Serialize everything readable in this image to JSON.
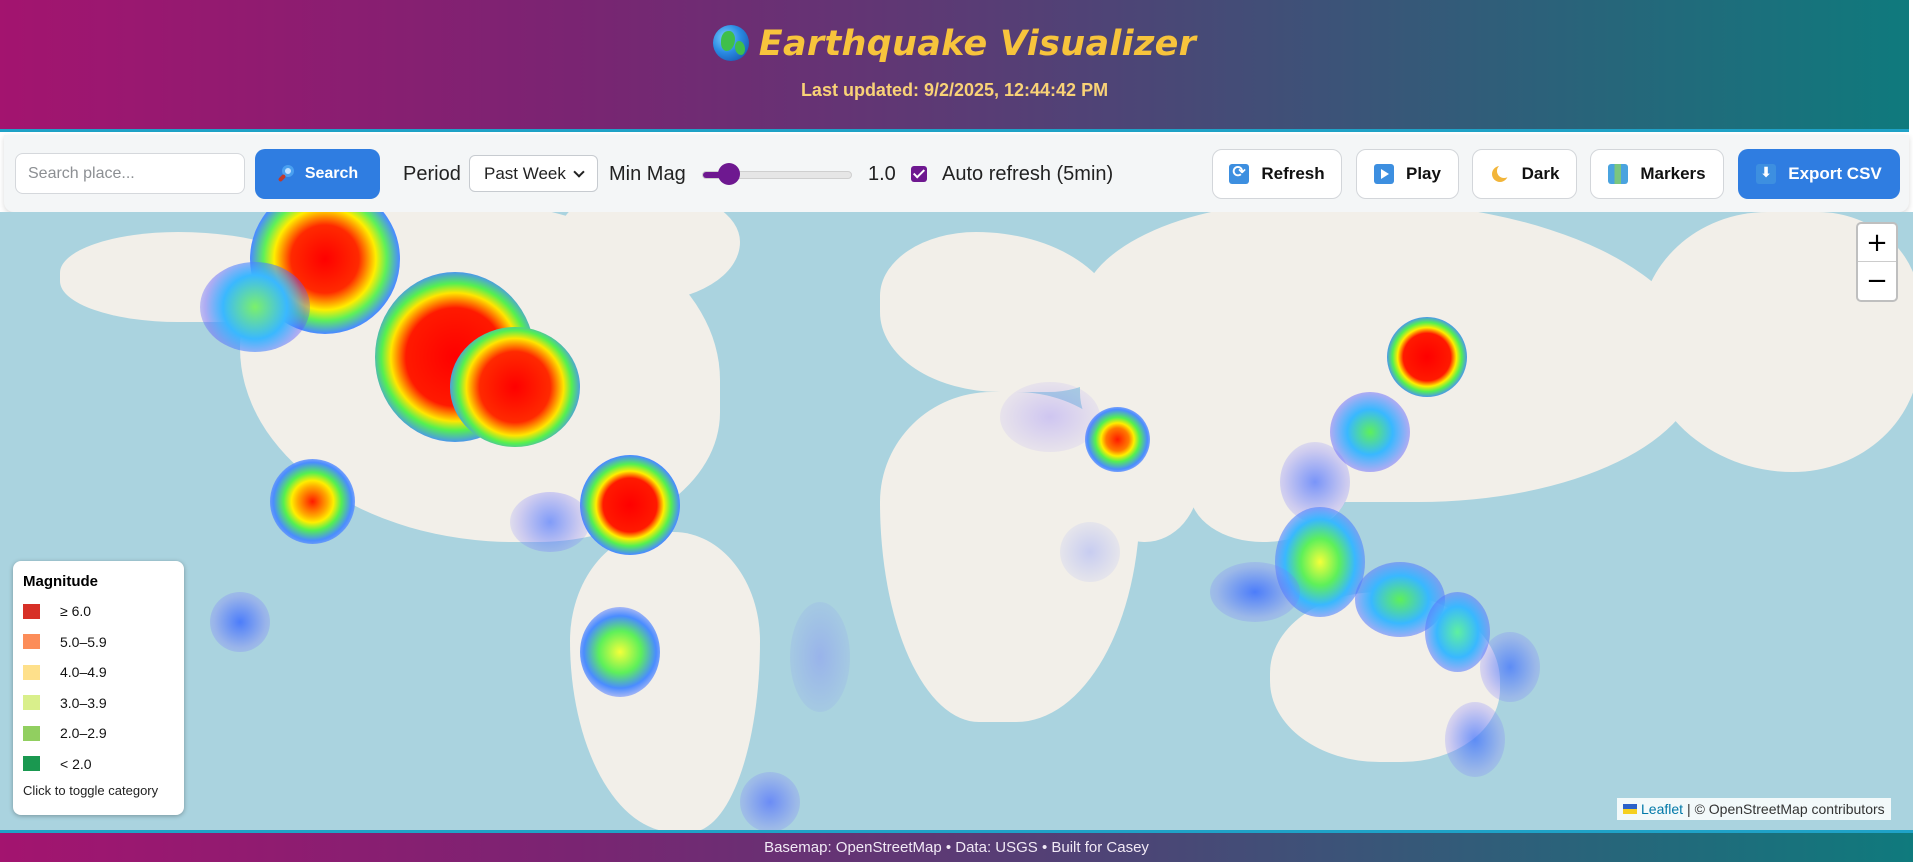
{
  "header": {
    "title": "Earthquake Visualizer",
    "updated": "Last updated: 9/2/2025, 12:44:42 PM"
  },
  "toolbar": {
    "search_placeholder": "Search place...",
    "search_label": "Search",
    "period_label": "Period",
    "period_value": "Past Week",
    "min_mag_label": "Min Mag",
    "min_mag_value": "1.0",
    "min_mag_fraction": 0.18,
    "auto_refresh_label": "Auto refresh (5min)",
    "auto_refresh_checked": true,
    "refresh_label": "Refresh",
    "play_label": "Play",
    "dark_label": "Dark",
    "markers_label": "Markers",
    "export_label": "Export CSV"
  },
  "map": {
    "zoom_in": "+",
    "zoom_out": "−",
    "attribution_link": "Leaflet",
    "attribution_text": "| © OpenStreetMap contributors"
  },
  "legend": {
    "title": "Magnitude",
    "items": [
      {
        "label": "≥ 6.0",
        "color": "#d73027"
      },
      {
        "label": "5.0–5.9",
        "color": "#fc8d59"
      },
      {
        "label": "4.0–4.9",
        "color": "#fee08b"
      },
      {
        "label": "3.0–3.9",
        "color": "#d9ef8b"
      },
      {
        "label": "2.0–2.9",
        "color": "#91cf60"
      },
      {
        "label": "< 2.0",
        "color": "#1a9850"
      }
    ],
    "hint": "Click to toggle category"
  },
  "footer": {
    "text": "Basemap: OpenStreetMap • Data: USGS • Built for Casey"
  }
}
